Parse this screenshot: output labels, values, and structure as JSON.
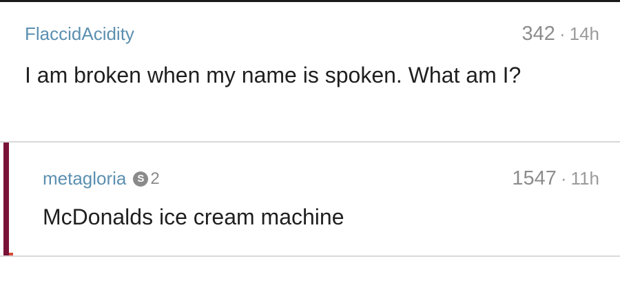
{
  "colors": {
    "username": "#5b8fb0",
    "meta": "#9a9a9a",
    "body_text": "#1f1f1f",
    "thread_bar": "#7a1238",
    "divider": "#d8d8d8"
  },
  "comments": [
    {
      "username": "FlaccidAcidity",
      "score": "342",
      "separator": "·",
      "age": "14h",
      "body": "I am broken when my name is spoken. What am I?"
    },
    {
      "username": "metagloria",
      "flair": {
        "icon": "s-badge-icon",
        "icon_glyph": "S",
        "count": "2"
      },
      "score": "1547",
      "separator": "·",
      "age": "11h",
      "body": "McDonalds ice cream machine"
    }
  ]
}
